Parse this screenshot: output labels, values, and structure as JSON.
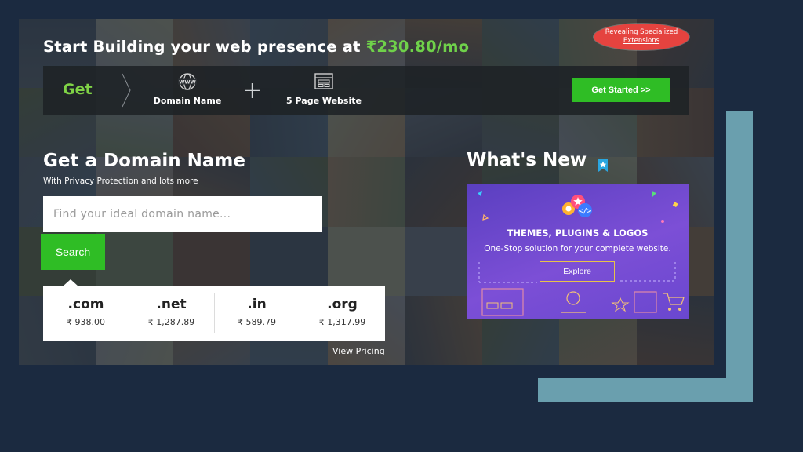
{
  "colors": {
    "accent_green": "#2fbd25",
    "price_green": "#6fd14a",
    "ribbon_red": "#e5433f",
    "promo_purple": "#6a47cf"
  },
  "header": {
    "headline": "Start Building your web presence at",
    "price": "₹230.80/mo",
    "ribbon_line1": "Revealing Specialized",
    "ribbon_line2": "Extensions"
  },
  "bundle_bar": {
    "get_label": "Get",
    "item1_label": "Domain Name",
    "item1_icon": "www-globe-icon",
    "plus": "+",
    "item2_label": "5 Page Website",
    "item2_icon": "website-layout-icon",
    "cta_label": "Get Started >>"
  },
  "domain_search": {
    "title": "Get a Domain Name",
    "subtitle": "With Privacy Protection and lots more",
    "placeholder": "Find your ideal domain name...",
    "button_label": "Search",
    "tlds": [
      {
        "ext": ".com",
        "price": "₹ 938.00"
      },
      {
        "ext": ".net",
        "price": "₹ 1,287.89"
      },
      {
        "ext": ".in",
        "price": "₹ 589.79"
      },
      {
        "ext": ".org",
        "price": "₹ 1,317.99"
      }
    ],
    "view_pricing": "View Pricing"
  },
  "whats_new": {
    "title": "What's New",
    "badge_icon": "bookmark-star-icon",
    "promo_heading": "THEMES, PLUGINS & LOGOS",
    "promo_sub": "One-Stop solution for your complete website.",
    "explore_label": "Explore"
  }
}
